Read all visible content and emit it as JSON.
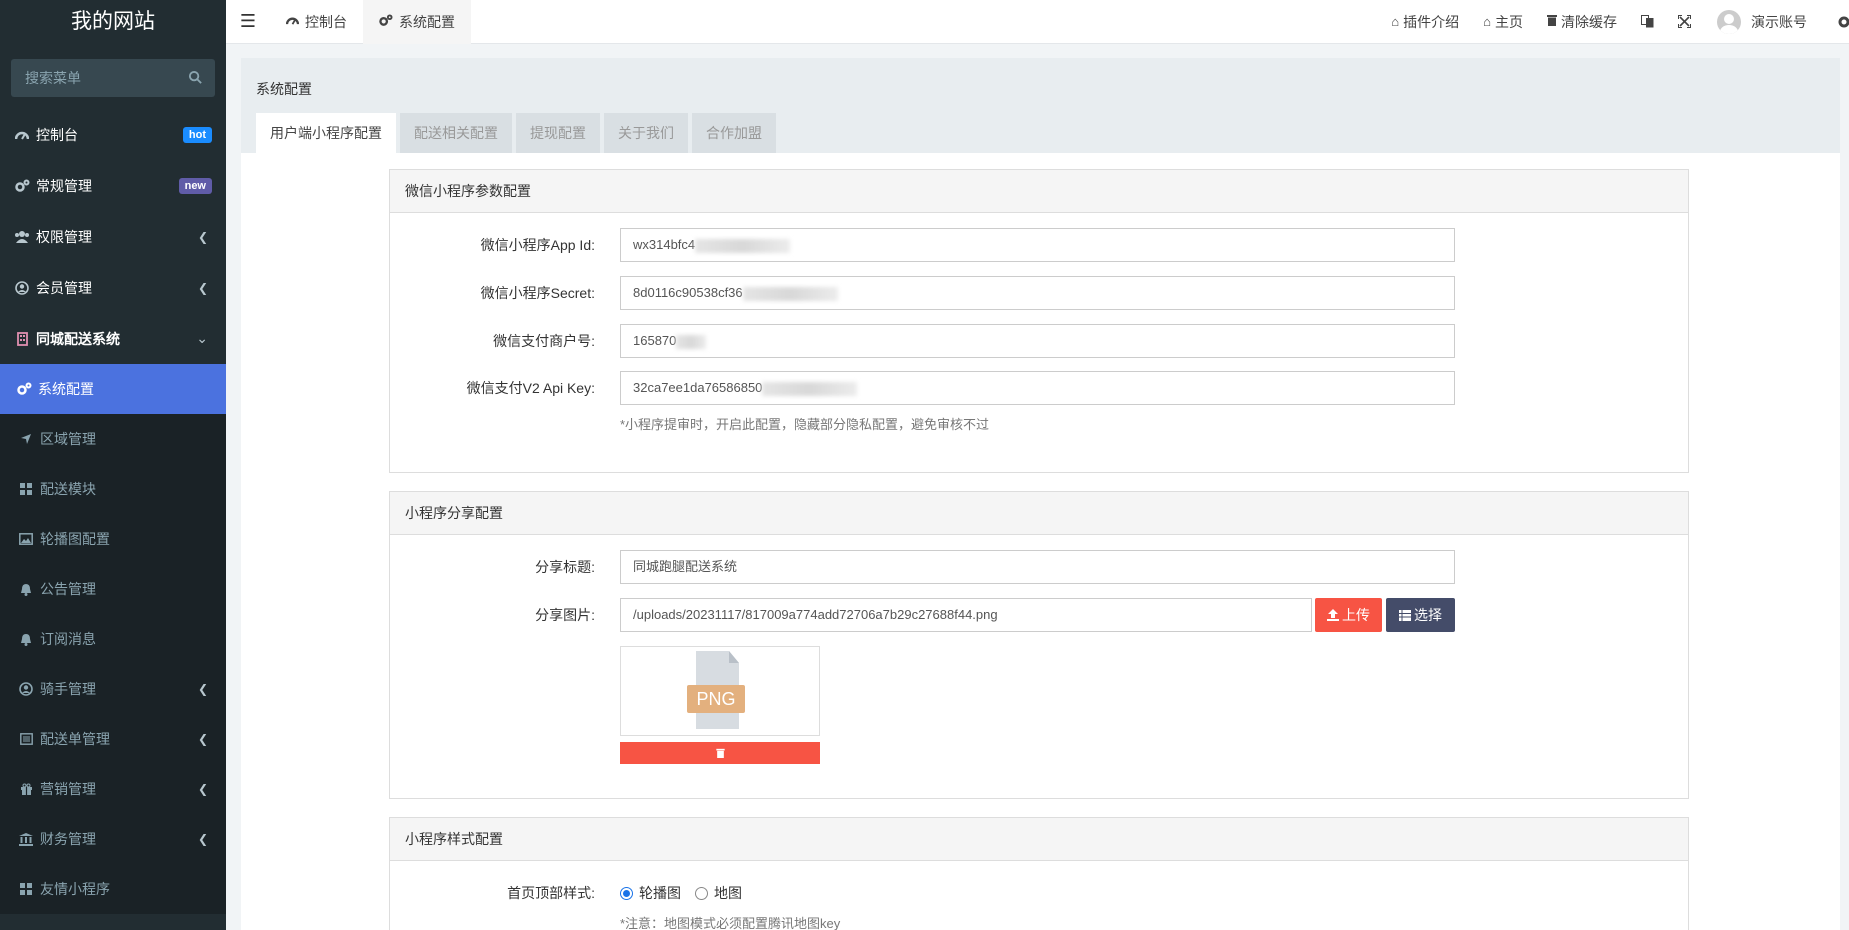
{
  "site": {
    "title": "我的网站"
  },
  "search": {
    "placeholder": "搜索菜单"
  },
  "sidebar": {
    "items": [
      {
        "label": "控制台",
        "badge": "hot",
        "icon": "dashboard-icon"
      },
      {
        "label": "常规管理",
        "badge": "new",
        "icon": "cogs-icon"
      },
      {
        "label": "权限管理",
        "icon": "users-icon"
      },
      {
        "label": "会员管理",
        "icon": "user-circle-icon"
      },
      {
        "label": "同城配送系统",
        "icon": "building-icon"
      }
    ],
    "sub": [
      {
        "label": "系统配置",
        "icon": "cogs-icon",
        "active": true
      },
      {
        "label": "区域管理",
        "icon": "location-arrow-icon"
      },
      {
        "label": "配送模块",
        "icon": "grid-icon"
      },
      {
        "label": "轮播图配置",
        "icon": "image-icon"
      },
      {
        "label": "公告管理",
        "icon": "bell-icon"
      },
      {
        "label": "订阅消息",
        "icon": "bell-icon"
      },
      {
        "label": "骑手管理",
        "icon": "user-circle-icon"
      },
      {
        "label": "配送单管理",
        "icon": "list-alt-icon"
      },
      {
        "label": "营销管理",
        "icon": "gift-icon"
      },
      {
        "label": "财务管理",
        "icon": "bank-icon"
      },
      {
        "label": "友情小程序",
        "icon": "grid-icon"
      }
    ]
  },
  "header": {
    "tabs": [
      {
        "label": "控制台"
      },
      {
        "label": "系统配置"
      }
    ],
    "links": {
      "plugin": "插件介绍",
      "home": "主页",
      "clear_cache": "清除缓存",
      "account": "演示账号"
    }
  },
  "page": {
    "title": "系统配置",
    "tabs": [
      "用户端小程序配置",
      "配送相关配置",
      "提现配置",
      "关于我们",
      "合作加盟"
    ]
  },
  "wechat": {
    "title": "微信小程序参数配置",
    "appid_label": "微信小程序App Id:",
    "appid_value": "wx314bfc4",
    "secret_label": "微信小程序Secret:",
    "secret_value": "8d0116c90538cf36",
    "mch_label": "微信支付商户号:",
    "mch_value": "165870",
    "apikey_label": "微信支付V2 Api Key:",
    "apikey_value": "32ca7ee1da76586850",
    "hint": "*小程序提审时，开启此配置，隐藏部分隐私配置，避免审核不过"
  },
  "share": {
    "title": "小程序分享配置",
    "title_label": "分享标题:",
    "title_value": "同城跑腿配送系统",
    "image_label": "分享图片:",
    "image_value": "/uploads/20231117/817009a774add72706a7b29c27688f44.png",
    "upload_label": "上传",
    "select_label": "选择",
    "preview_text": "PNG"
  },
  "style": {
    "title": "小程序样式配置",
    "header_label": "首页顶部样式:",
    "option_banner": "轮播图",
    "option_map": "地图",
    "hint": "*注意：地图模式必须配置腾讯地图key"
  }
}
